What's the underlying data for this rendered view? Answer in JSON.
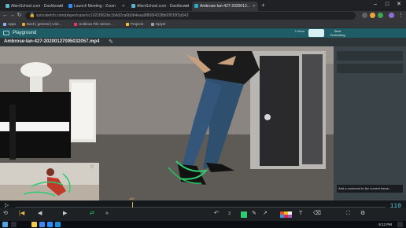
{
  "browser": {
    "tabs": [
      {
        "label": "AlienSchool.com - Dashboard",
        "fav": "#5bb5c8",
        "active": false
      },
      {
        "label": "Launch Meeting - Zoom",
        "fav": "#2d8cff",
        "active": false
      },
      {
        "label": "AlienSchool.com - Dashboard",
        "fav": "#5bb5c8",
        "active": false
      },
      {
        "label": "Ambrose-Ian-427-2020012...",
        "fav": "#2aa9c4",
        "active": true
      }
    ],
    "new_tab": "+",
    "url": "syncsketch.com/player/case/cc1021f962bc1b6d2ca6b0b4eaa9f808/4338b00f1f3f2a543",
    "bookmarks": [
      {
        "label": "Apps",
        "color": "#8ab4f8"
      },
      {
        "label": "Back | general | Unit...",
        "color": "#e8a838"
      },
      {
        "label": "Unibloxx File Server...",
        "color": "#e36"
      },
      {
        "label": "Projects",
        "color": "#f3c13a"
      },
      {
        "label": "Epiyer",
        "color": "#9aa0a6"
      }
    ]
  },
  "app": {
    "section": "Playground",
    "file_name": "Ambrose-Ian-427-20200127095032057.mp4",
    "review_label": "Start Presenting",
    "viewer_label": "1 More"
  },
  "player": {
    "frame_marker": "110",
    "timecode": "110",
    "note_text": "Add a comment to the current frame..."
  },
  "taskbar": {
    "time": "9:12 PM",
    "date": "1/27/2020",
    "search_placeholder": "Type here to search"
  },
  "colors": {
    "accent": "#5ec8d8",
    "header": "#1f5d66",
    "annotation": "#2ecc71"
  }
}
